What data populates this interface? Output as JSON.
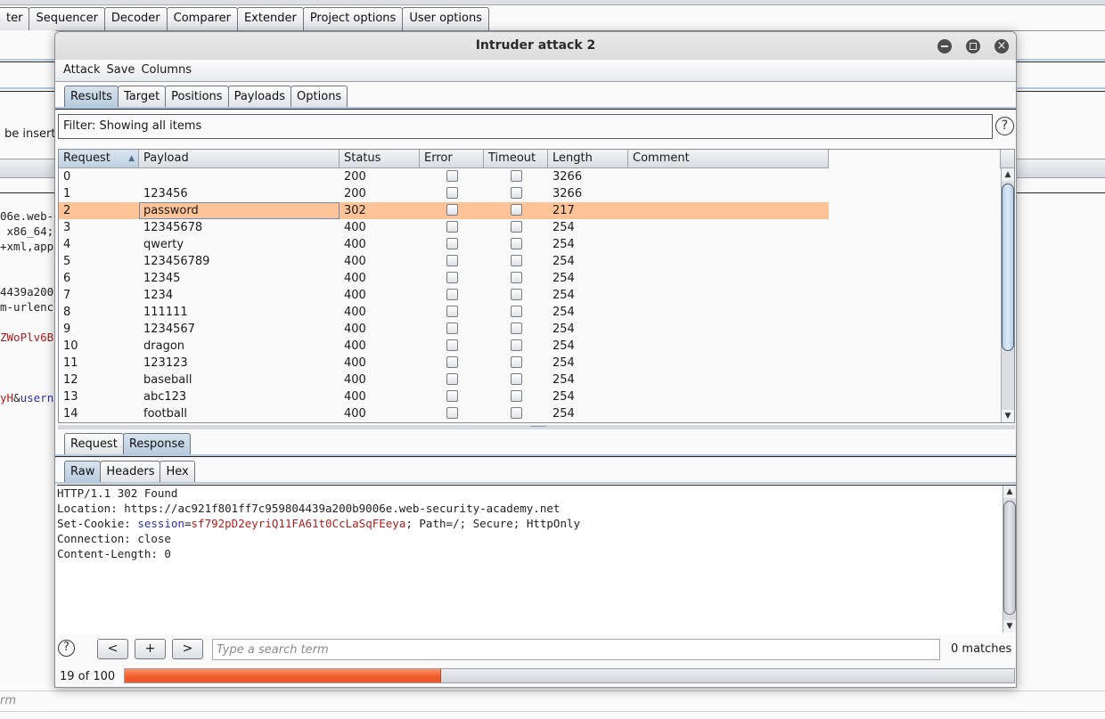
{
  "background": {
    "tabs": [
      "ter",
      "Sequencer",
      "Decoder",
      "Comparer",
      "Extender",
      "Project options",
      "User options"
    ],
    "partial_text": "be insert",
    "code_lines": [
      {
        "text": "06e.web-",
        "style": "plain"
      },
      {
        "text": " x86_64;",
        "style": "plain"
      },
      {
        "text": "+xml,app",
        "style": "plain"
      },
      {
        "text": "4439a200",
        "style": "plain"
      },
      {
        "text": "m-urlenc",
        "style": "plain"
      },
      {
        "text": "ZWoPlv6B",
        "style": "red"
      },
      {
        "text": "yH&usern",
        "style": "mixed"
      }
    ],
    "bottom_search_placeholder": "rm"
  },
  "dialog": {
    "title": "Intruder attack 2",
    "window_controls": [
      "minimize-icon",
      "maximize-icon",
      "close-icon"
    ],
    "menu": [
      "Attack",
      "Save",
      "Columns"
    ],
    "tabs": [
      {
        "label": "Results",
        "active": true
      },
      {
        "label": "Target",
        "active": false
      },
      {
        "label": "Positions",
        "active": false
      },
      {
        "label": "Payloads",
        "active": false
      },
      {
        "label": "Options",
        "active": false
      }
    ],
    "filter_text": "Filter: Showing all items",
    "help_glyph": "?",
    "table": {
      "columns": [
        "Request",
        "Payload",
        "Status",
        "Error",
        "Timeout",
        "Length",
        "Comment"
      ],
      "sorted_column": "Request",
      "sort_direction": "ascending",
      "selected_row": 2,
      "rows": [
        {
          "request": "0",
          "payload": "",
          "status": "200",
          "error": false,
          "timeout": false,
          "length": "3266",
          "comment": ""
        },
        {
          "request": "1",
          "payload": "123456",
          "status": "200",
          "error": false,
          "timeout": false,
          "length": "3266",
          "comment": ""
        },
        {
          "request": "2",
          "payload": "password",
          "status": "302",
          "error": false,
          "timeout": false,
          "length": "217",
          "comment": ""
        },
        {
          "request": "3",
          "payload": "12345678",
          "status": "400",
          "error": false,
          "timeout": false,
          "length": "254",
          "comment": ""
        },
        {
          "request": "4",
          "payload": "qwerty",
          "status": "400",
          "error": false,
          "timeout": false,
          "length": "254",
          "comment": ""
        },
        {
          "request": "5",
          "payload": "123456789",
          "status": "400",
          "error": false,
          "timeout": false,
          "length": "254",
          "comment": ""
        },
        {
          "request": "6",
          "payload": "12345",
          "status": "400",
          "error": false,
          "timeout": false,
          "length": "254",
          "comment": ""
        },
        {
          "request": "7",
          "payload": "1234",
          "status": "400",
          "error": false,
          "timeout": false,
          "length": "254",
          "comment": ""
        },
        {
          "request": "8",
          "payload": "111111",
          "status": "400",
          "error": false,
          "timeout": false,
          "length": "254",
          "comment": ""
        },
        {
          "request": "9",
          "payload": "1234567",
          "status": "400",
          "error": false,
          "timeout": false,
          "length": "254",
          "comment": ""
        },
        {
          "request": "10",
          "payload": "dragon",
          "status": "400",
          "error": false,
          "timeout": false,
          "length": "254",
          "comment": ""
        },
        {
          "request": "11",
          "payload": "123123",
          "status": "400",
          "error": false,
          "timeout": false,
          "length": "254",
          "comment": ""
        },
        {
          "request": "12",
          "payload": "baseball",
          "status": "400",
          "error": false,
          "timeout": false,
          "length": "254",
          "comment": ""
        },
        {
          "request": "13",
          "payload": "abc123",
          "status": "400",
          "error": false,
          "timeout": false,
          "length": "254",
          "comment": ""
        },
        {
          "request": "14",
          "payload": "football",
          "status": "400",
          "error": false,
          "timeout": false,
          "length": "254",
          "comment": ""
        }
      ]
    },
    "message_tabs": [
      {
        "label": "Request",
        "active": false
      },
      {
        "label": "Response",
        "active": true
      }
    ],
    "view_tabs": [
      {
        "label": "Raw",
        "active": true
      },
      {
        "label": "Headers",
        "active": false
      },
      {
        "label": "Hex",
        "active": false
      }
    ],
    "response": {
      "status_line": "HTTP/1.1 302 Found",
      "location": "Location: https://ac921f801ff7c959804439a200b9006e.web-security-academy.net",
      "set_cookie_prefix": "Set-Cookie: ",
      "cookie_name": "session",
      "cookie_eq": "=",
      "cookie_value": "sf792pD2eyriQ11FA61t0CcLaSqFEeya",
      "cookie_suffix": "; Path=/; Secure; HttpOnly",
      "connection": "Connection: close",
      "content_length": "Content-Length: 0"
    },
    "search": {
      "prev_label": "<",
      "add_label": "+",
      "next_label": ">",
      "placeholder": "Type a search term",
      "value": "",
      "matches": "0 matches"
    },
    "progress": {
      "label": "19 of 100",
      "completed": 19,
      "total": 100
    },
    "colors": {
      "selected_row": "#fec497",
      "progress_fill": "#f25a2a",
      "active_tab": "#b7cbdd",
      "cookie_name": "#2a2fb0",
      "cookie_value": "#b21c1c"
    }
  }
}
